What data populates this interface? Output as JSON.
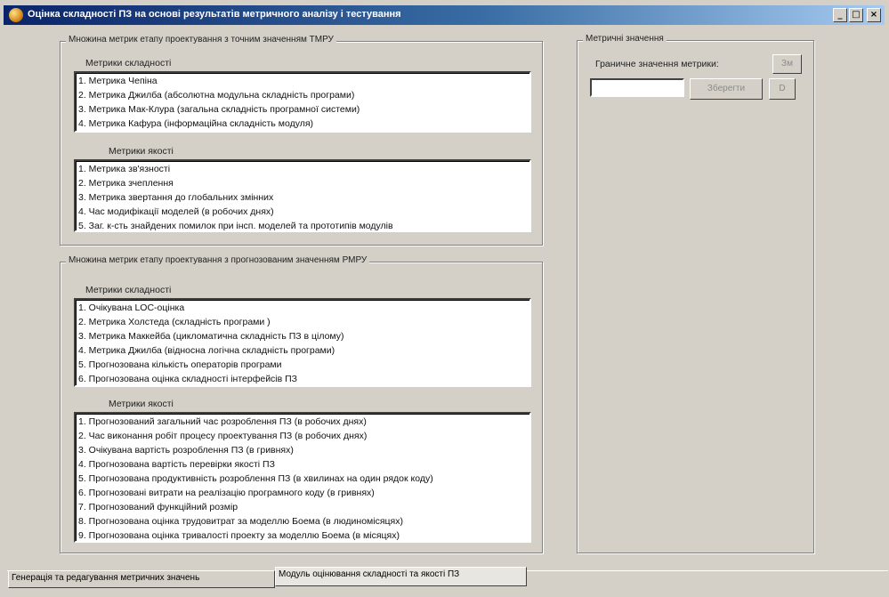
{
  "window": {
    "title": "Оцінка складності ПЗ на основі результатів метричного аналізу і тестування",
    "min_glyph": "_",
    "max_glyph": "□",
    "close_glyph": "×"
  },
  "group_tmpu": {
    "legend": "Множина метрик етапу проектування з точним значенням ТМРУ",
    "complexity": {
      "label": "Метрики складності",
      "items": [
        "1. Метрика Чепіна",
        "2. Метрика Джилба (абсолютна модульна складність програми)",
        "3. Метрика Мак-Клура (загальна складність програмної системи)",
        "4. Метрика Кафура (інформаційна складність модуля)"
      ]
    },
    "quality": {
      "label": "Метрики якості",
      "items": [
        "1. Метрика зв'язності",
        "2. Метрика зчеплення",
        "3. Метрика звертання до глобальних змінних",
        "4. Час модифікації моделей (в робочих днях)",
        "5. Заг. к-сть знайдених помилок при інсп. моделей та прототипів модулів"
      ]
    }
  },
  "group_pmpu": {
    "legend": "Множина метрик етапу проектування з прогнозованим значенням РМРУ",
    "complexity": {
      "label": "Метрики складності",
      "items": [
        "1. Очікувана LOC-оцінка",
        "2. Метрика Холстеда (складність програми )",
        "3. Метрика Маккейба (цикломатична складність ПЗ в цілому)",
        "4. Метрика Джилба (відносна логічна складність програми)",
        "5. Прогнозована кількість операторів програми",
        "6. Прогнозована оцінка складності інтерфейсів ПЗ"
      ]
    },
    "quality": {
      "label": "Метрики якості",
      "items": [
        "1. Прогнозований загальний час розроблення ПЗ (в робочих днях)",
        "2. Час виконання робіт процесу проектування ПЗ (в робочих днях)",
        "3. Очікувана вартість розроблення ПЗ (в гривнях)",
        "4. Прогнозована вартість перевірки якості ПЗ",
        "5. Прогнозована продуктивність розроблення ПЗ (в хвилинах на один рядок коду)",
        "6. Прогнозовані витрати на реалізацію програмного коду (в гривнях)",
        "7. Прогнозований функційний розмір",
        "8. Прогнозована оцінка трудовитрат за моделлю Боема (в людиномісяцях)",
        "9. Прогнозована оцінка тривалості проекту за моделлю Боема (в місяцях)"
      ]
    }
  },
  "metric_values": {
    "legend": "Метричні значення",
    "boundary_label": "Граничне значення метрики:",
    "small_button_label": "Зм",
    "input_value": "",
    "save_label": "Зберегти",
    "arrow_button_label": "D"
  },
  "tabs": [
    {
      "label": "Генерація та редагування метричних значень",
      "active": false
    },
    {
      "label": "Модуль оцінювання складності та якості ПЗ",
      "active": true
    }
  ]
}
